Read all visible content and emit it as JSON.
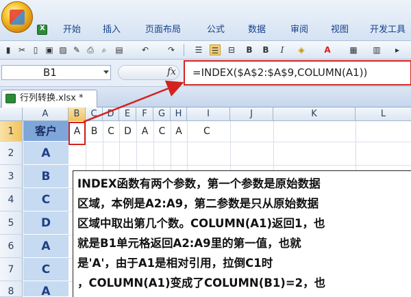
{
  "ribbon": {
    "tabs": [
      "开始",
      "插入",
      "页面布局",
      "公式",
      "数据",
      "审阅",
      "视图",
      "开发工具"
    ]
  },
  "formula_bar": {
    "name_box": "B1",
    "fx": "fx",
    "formula": "=INDEX($A$2:$A$9,COLUMN(A1))"
  },
  "workbook": {
    "tab_label": "行列转换.xlsx *"
  },
  "grid": {
    "columns": [
      "A",
      "B",
      "C",
      "D",
      "E",
      "F",
      "G",
      "H",
      "I",
      "J",
      "K",
      "L"
    ],
    "rows": [
      "1",
      "2",
      "3",
      "4",
      "5",
      "6",
      "7",
      "8"
    ],
    "column_a": [
      "客户",
      "A",
      "B",
      "C",
      "D",
      "A",
      "C",
      "A"
    ],
    "row1_values": [
      "A",
      "B",
      "C",
      "D",
      "A",
      "C",
      "A",
      "C"
    ]
  },
  "note": {
    "lines": [
      "INDEX函数有两个参数，第一个参数是原始数据",
      "区域，本例是A2:A9，第二参数是只从原始数据",
      "区域中取出第几个数。COLUMN(A1)返回1，也",
      "就是B1单元格返回A2:A9里的第一值，也就",
      "是'A'，由于A1是相对引用，拉倒C1时",
      "，COLUMN(A1)变成了COLUMN(B1)=2，也"
    ]
  },
  "colors": {
    "accent_red": "#d2231f",
    "header_blue": "#7fa6d8",
    "cell_blue": "#c6daf1"
  }
}
